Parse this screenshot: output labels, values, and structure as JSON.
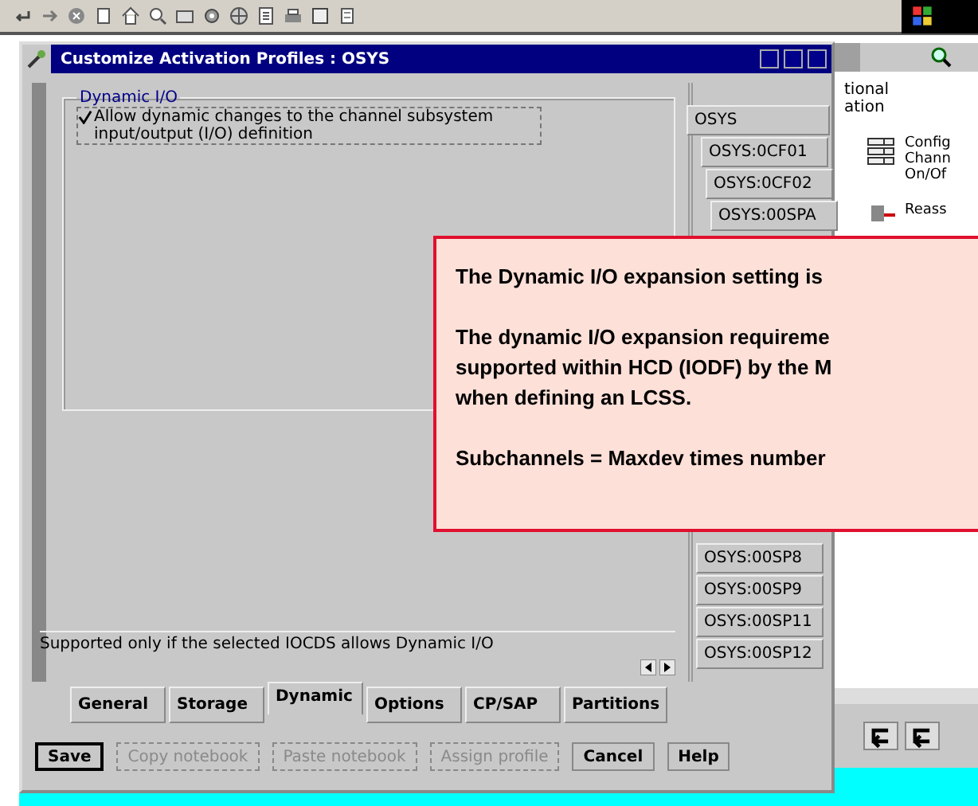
{
  "dialog": {
    "title": "Customize Activation Profiles : OSYS"
  },
  "group": {
    "title": "Dynamic I/O",
    "checkbox": {
      "label": "Allow dynamic changes to the channel subsystem input/output (I/O) definition",
      "checked": true
    }
  },
  "status_text": "Supported only if the selected IOCDS allows Dynamic I/O",
  "profile_tabs_upper": [
    {
      "label": "OSYS",
      "selected": true
    },
    {
      "label": "OSYS:0CF01",
      "selected": false
    },
    {
      "label": "OSYS:0CF02",
      "selected": false
    },
    {
      "label": "OSYS:00SPA",
      "selected": false
    }
  ],
  "profile_tabs_lower": [
    {
      "label": "OSYS:00SP8",
      "selected": false
    },
    {
      "label": "OSYS:00SP9",
      "selected": false
    },
    {
      "label": "OSYS:00SP11",
      "selected": false
    },
    {
      "label": "OSYS:00SP12",
      "selected": false
    }
  ],
  "page_tabs": [
    {
      "label": "General",
      "selected": false
    },
    {
      "label": "Storage",
      "selected": false
    },
    {
      "label": "Dynamic",
      "selected": true
    },
    {
      "label": "Options",
      "selected": false
    },
    {
      "label": "CP/SAP",
      "selected": false
    },
    {
      "label": "Partitions",
      "selected": false
    }
  ],
  "buttons": [
    {
      "label": "Save",
      "disabled": false
    },
    {
      "label": "Copy notebook",
      "disabled": true
    },
    {
      "label": "Paste notebook",
      "disabled": true
    },
    {
      "label": "Assign profile",
      "disabled": true
    },
    {
      "label": "Cancel",
      "disabled": false
    },
    {
      "label": "Help",
      "disabled": false
    }
  ],
  "side_panel": {
    "heading_lines": [
      "tional",
      "ation"
    ],
    "task_lines": [
      "Config",
      "Chann",
      "On/Of"
    ],
    "task_2": "Reass"
  },
  "callout": {
    "paragraphs": [
      [
        "The Dynamic I/O expansion setting is"
      ],
      [
        "The dynamic I/O expansion requireme",
        "supported within HCD (IODF) by the M",
        "when defining an LCSS."
      ],
      [
        "Subchannels = Maxdev times number"
      ]
    ]
  }
}
